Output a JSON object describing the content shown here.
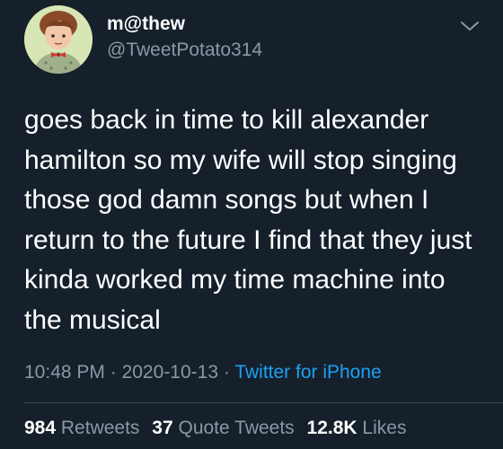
{
  "author": {
    "display_name": "m@thew",
    "handle": "@TweetPotato314",
    "avatar_icon": "avatar-illustration"
  },
  "menu_icon": "chevron-down-icon",
  "tweet": {
    "lines": [
      "goes back in time to kill alexander",
      "hamilton so my wife will stop singing",
      "those god damn songs but when I",
      "return to the future I find that they just",
      "kinda worked my time machine into",
      "the musical"
    ]
  },
  "meta": {
    "time": "10:48 PM",
    "separator": "·",
    "date": "2020-10-13",
    "source": "Twitter for iPhone"
  },
  "stats": {
    "retweets_count": "984",
    "retweets_label": "Retweets",
    "quotes_count": "37",
    "quotes_label": "Quote Tweets",
    "likes_count": "12.8K",
    "likes_label": "Likes"
  },
  "colors": {
    "background": "#15202b",
    "text": "#ffffff",
    "muted": "#8899a6",
    "link": "#1da1f2",
    "divider": "#38444d"
  }
}
